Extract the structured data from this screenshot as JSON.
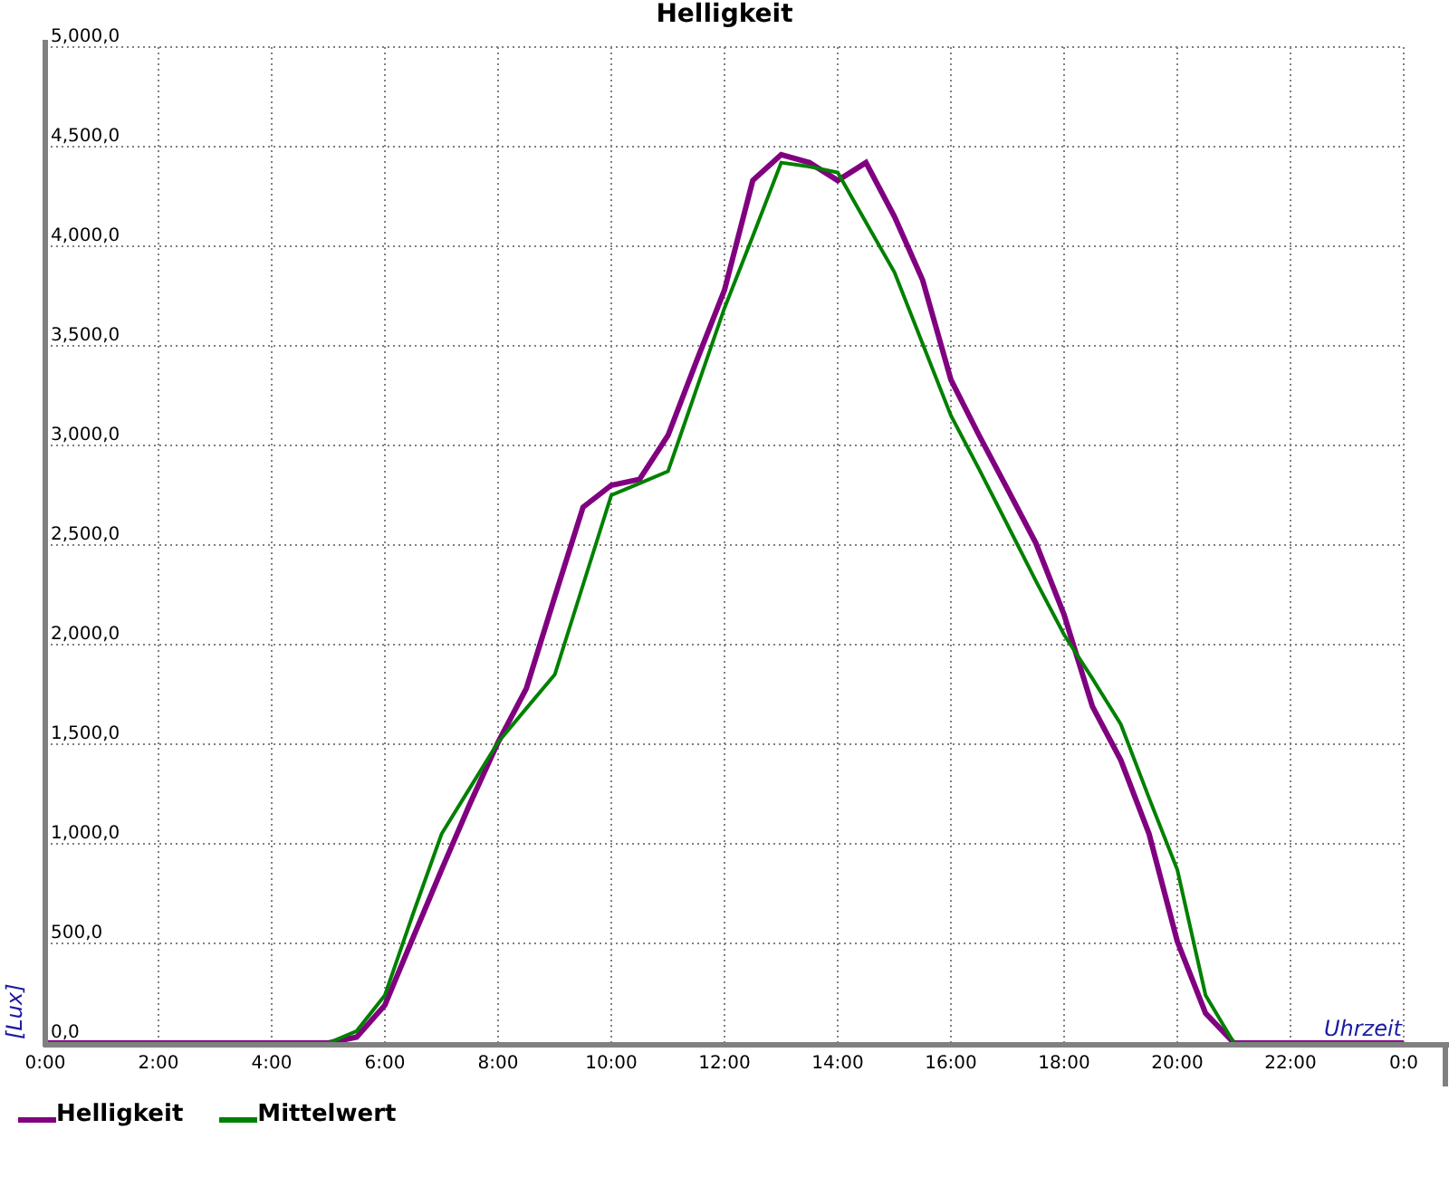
{
  "chart": {
    "chart_data": {
      "type": "line",
      "title": "Helligkeit",
      "xlabel": "Uhrzeit",
      "ylabel": "[Lux]",
      "x": [
        0,
        0.5,
        1,
        1.5,
        2,
        2.5,
        3,
        3.5,
        4,
        4.5,
        5,
        5.5,
        6,
        6.5,
        7,
        7.5,
        8,
        8.5,
        9,
        9.5,
        10,
        10.5,
        11,
        11.5,
        12,
        12.5,
        13,
        13.5,
        14,
        14.5,
        15,
        15.5,
        16,
        16.5,
        17,
        17.5,
        18,
        18.5,
        19,
        19.5,
        20,
        20.5,
        21,
        21.5,
        22,
        22.5,
        23,
        23.5,
        24
      ],
      "series": [
        {
          "name": "Helligkeit",
          "color": "#800080",
          "values": [
            0,
            0,
            0,
            0,
            0,
            0,
            0,
            0,
            0,
            0,
            0,
            30,
            190,
            530,
            870,
            1200,
            1510,
            1780,
            2240,
            2690,
            2800,
            2830,
            3050,
            3420,
            3780,
            4330,
            4460,
            4420,
            4330,
            4420,
            4150,
            3830,
            3330,
            3050,
            2780,
            2510,
            2150,
            1690,
            1420,
            1050,
            510,
            150,
            0,
            0,
            0,
            0,
            0,
            0,
            0
          ]
        },
        {
          "name": "Mittelwert",
          "color": "#008000",
          "values": [
            0,
            0,
            0,
            0,
            0,
            0,
            0,
            0,
            0,
            0,
            0,
            60,
            240,
            650,
            1050,
            1280,
            1510,
            1680,
            1850,
            2300,
            2750,
            2810,
            2870,
            3280,
            3690,
            4050,
            4420,
            4400,
            4370,
            4120,
            3870,
            3510,
            3150,
            2880,
            2600,
            2320,
            2050,
            1830,
            1600,
            1230,
            870,
            240,
            0,
            0,
            0,
            0,
            0,
            0,
            0
          ]
        }
      ],
      "grid": true,
      "xlim": [
        0,
        24
      ],
      "ylim": [
        0,
        5000
      ],
      "xticks": [
        {
          "value": 0,
          "label": "0:00"
        },
        {
          "value": 2,
          "label": "2:00"
        },
        {
          "value": 4,
          "label": "4:00"
        },
        {
          "value": 6,
          "label": "6:00"
        },
        {
          "value": 8,
          "label": "8:00"
        },
        {
          "value": 10,
          "label": "10:00"
        },
        {
          "value": 12,
          "label": "12:00"
        },
        {
          "value": 14,
          "label": "14:00"
        },
        {
          "value": 16,
          "label": "16:00"
        },
        {
          "value": 18,
          "label": "18:00"
        },
        {
          "value": 20,
          "label": "20:00"
        },
        {
          "value": 22,
          "label": "22:00"
        },
        {
          "value": 24,
          "label": "0:0"
        }
      ],
      "yticks": [
        {
          "value": 0,
          "label": "0,0"
        },
        {
          "value": 500,
          "label": "500,0"
        },
        {
          "value": 1000,
          "label": "1,000,0"
        },
        {
          "value": 1500,
          "label": "1,500,0"
        },
        {
          "value": 2000,
          "label": "2,000,0"
        },
        {
          "value": 2500,
          "label": "2,500,0"
        },
        {
          "value": 3000,
          "label": "3,000,0"
        },
        {
          "value": 3500,
          "label": "3,500,0"
        },
        {
          "value": 4000,
          "label": "4,000,0"
        },
        {
          "value": 4500,
          "label": "4,500,0"
        },
        {
          "value": 5000,
          "label": "5,000,0"
        }
      ]
    }
  }
}
